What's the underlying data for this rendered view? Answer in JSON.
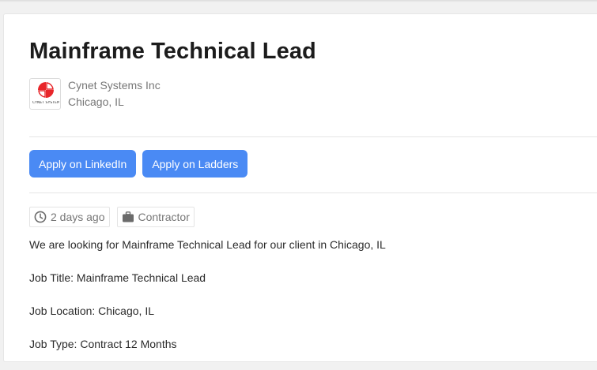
{
  "job": {
    "title": "Mainframe Technical Lead",
    "company": "Cynet Systems Inc",
    "location": "Chicago, IL",
    "logo_text": "CYNET SYSTEMS",
    "logo_icon": "cynet-logo-icon"
  },
  "actions": {
    "apply_linkedin": "Apply on LinkedIn",
    "apply_ladders": "Apply on Ladders"
  },
  "meta": {
    "posted": "2 days ago",
    "posted_icon": "clock-icon",
    "type": "Contractor",
    "type_icon": "briefcase-icon"
  },
  "description": [
    "We are looking for Mainframe Technical Lead for our client in Chicago, IL",
    "Job Title: Mainframe Technical Lead",
    "Job Location: Chicago, IL",
    "Job Type: Contract 12 Months"
  ],
  "colors": {
    "button": "#4a8af4",
    "logo_red": "#e8262a"
  }
}
